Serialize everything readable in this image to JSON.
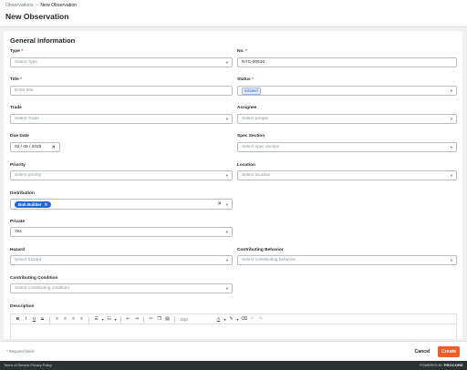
{
  "header": {
    "breadcrumb_parent": "Observations",
    "breadcrumb_current": "New Observation",
    "title": "New Observation"
  },
  "form": {
    "section_title": "General Information",
    "type": {
      "label": "Type",
      "required": "*",
      "placeholder": "Select Type"
    },
    "number": {
      "label": "No.",
      "required": "*",
      "value": "NYC-00516"
    },
    "title": {
      "label": "Title",
      "required": "*",
      "placeholder": "Enter title"
    },
    "status": {
      "label": "Status",
      "required": "*",
      "value": "Initiated"
    },
    "trade": {
      "label": "Trade",
      "placeholder": "Select Trade"
    },
    "assignee": {
      "label": "Assignee",
      "placeholder": "Select people"
    },
    "due_date": {
      "label": "Due Date",
      "value": "02 / 05 / 2025"
    },
    "spec_section": {
      "label": "Spec Section",
      "placeholder": "Select spec section"
    },
    "priority": {
      "label": "Priority",
      "placeholder": "Select priority"
    },
    "location": {
      "label": "Location",
      "placeholder": "Select location"
    },
    "distribution": {
      "label": "Distribution",
      "chip": "Bob Builder"
    },
    "private": {
      "label": "Private",
      "value": "Yes"
    },
    "hazard": {
      "label": "Hazard",
      "placeholder": "Select hazard"
    },
    "contributing_behavior": {
      "label": "Contributing Behavior",
      "placeholder": "Select contributing behavior"
    },
    "contributing_condition": {
      "label": "Contributing Condition",
      "placeholder": "Select contributing condition"
    },
    "description": {
      "label": "Description",
      "font_size": "12pt"
    }
  },
  "footer": {
    "required_note": "* Required fields",
    "cancel_label": "Cancel",
    "create_label": "Create"
  },
  "bottom": {
    "links": "Terms of Service  Privacy Policy",
    "powered_prefix": "POWERED BY",
    "brand": "PROCORE"
  },
  "colors": {
    "primary": "#f15c28",
    "chip": "#2066df",
    "status_badge": "#2064c9"
  }
}
